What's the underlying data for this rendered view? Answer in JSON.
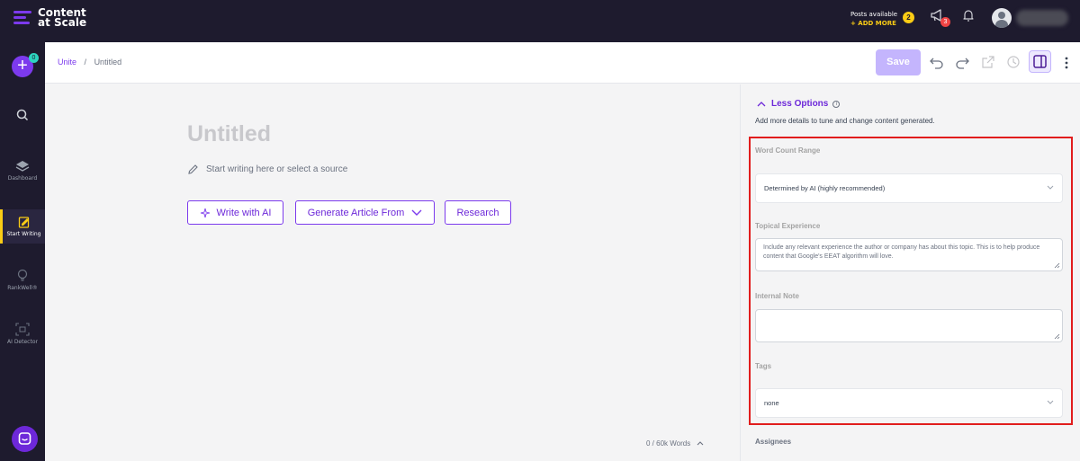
{
  "topbar": {
    "brand_line1": "Content",
    "brand_line2": "at Scale",
    "posts_label": "Posts available",
    "add_more": "+ ADD MORE",
    "posts_count": "2",
    "notifications_count": "3",
    "icons": {
      "announcements": "megaphone-icon",
      "alerts": "bell-icon",
      "user": "avatar"
    },
    "colors": {
      "background": "#1e1b2e",
      "accent": "#7c3aed",
      "highlight": "#facc15"
    }
  },
  "sidebar": {
    "new_badge": "0",
    "items": [
      {
        "label": "",
        "icon": "search-icon"
      },
      {
        "label": "Dashboard",
        "icon": "layers-icon"
      },
      {
        "label": "Start Writing",
        "icon": "edit-icon",
        "active": true
      },
      {
        "label": "RankWell®",
        "icon": "lightbulb-icon"
      },
      {
        "label": "AI Detector",
        "icon": "scan-icon"
      }
    ]
  },
  "header": {
    "breadcrumb_parent": "Unite",
    "breadcrumb_sep": "/",
    "breadcrumb_current": "Untitled",
    "save_label": "Save"
  },
  "editor": {
    "title_placeholder": "Untitled",
    "body_placeholder": "Start writing here or select a source",
    "write_ai": "Write with AI",
    "generate": "Generate Article From",
    "research": "Research",
    "word_count": "0 / 60k Words"
  },
  "panel": {
    "less_options": "Less Options",
    "description": "Add more details to tune and change content generated.",
    "word_count_range_label": "Word Count Range",
    "word_count_range_value": "Determined by AI (highly recommended)",
    "topical_label": "Topical Experience",
    "topical_placeholder": "Include any relevant experience the author or company has about this topic. This is to help produce content that Google's EEAT algorithm will love.",
    "internal_note_label": "Internal Note",
    "internal_note_value": "",
    "tags_label": "Tags",
    "tags_value": "none",
    "assignees_label": "Assignees"
  }
}
